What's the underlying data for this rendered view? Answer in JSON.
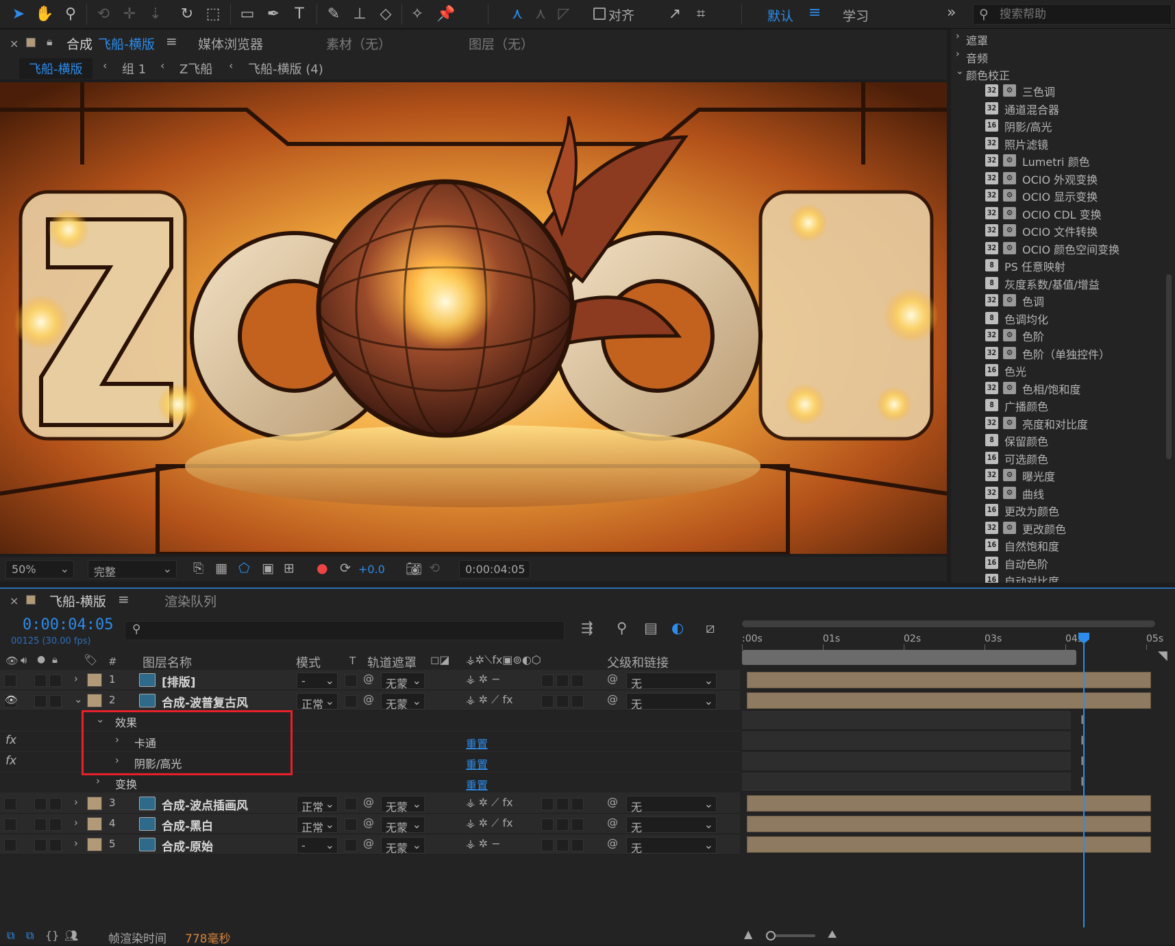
{
  "toolbar": {
    "align_label": "对齐",
    "workspace_default": "默认",
    "workspace_learn": "学习",
    "help_placeholder": "搜索帮助"
  },
  "comp_panel": {
    "tab_prefix": "合成",
    "tab_name": "飞船-横版",
    "tab_media": "媒体浏览器",
    "tab_footage": "素材（无）",
    "tab_layer": "图层（无）",
    "breadcrumbs": [
      "飞船-横版",
      "组 1",
      "Z飞船",
      "飞船-横版 (4)"
    ]
  },
  "viewer_controls": {
    "zoom": "50%",
    "resolution": "完整",
    "exposure": "+0.0",
    "timecode": "0:00:04:05"
  },
  "effects_panel": {
    "categories": [
      {
        "label": "遮罩",
        "expanded": false
      },
      {
        "label": "音频",
        "expanded": false
      },
      {
        "label": "颜色校正",
        "expanded": true
      }
    ],
    "items": [
      {
        "bits": "32",
        "gpu": true,
        "label": "三色调"
      },
      {
        "bits": "32",
        "gpu": false,
        "label": "通道混合器"
      },
      {
        "bits": "16",
        "gpu": false,
        "label": "阴影/高光"
      },
      {
        "bits": "32",
        "gpu": false,
        "label": "照片滤镜"
      },
      {
        "bits": "32",
        "gpu": true,
        "label": "Lumetri 颜色"
      },
      {
        "bits": "32",
        "gpu": true,
        "label": "OCIO 外观变换"
      },
      {
        "bits": "32",
        "gpu": true,
        "label": "OCIO 显示变换"
      },
      {
        "bits": "32",
        "gpu": true,
        "label": "OCIO CDL 变换"
      },
      {
        "bits": "32",
        "gpu": true,
        "label": "OCIO 文件转换"
      },
      {
        "bits": "32",
        "gpu": true,
        "label": "OCIO 颜色空间变换"
      },
      {
        "bits": "8",
        "gpu": false,
        "label": "PS 任意映射"
      },
      {
        "bits": "8",
        "gpu": false,
        "label": "灰度系数/基值/增益"
      },
      {
        "bits": "32",
        "gpu": true,
        "label": "色调"
      },
      {
        "bits": "8",
        "gpu": false,
        "label": "色调均化"
      },
      {
        "bits": "32",
        "gpu": true,
        "label": "色阶"
      },
      {
        "bits": "32",
        "gpu": true,
        "label": "色阶（单独控件）"
      },
      {
        "bits": "16",
        "gpu": false,
        "label": "色光"
      },
      {
        "bits": "32",
        "gpu": true,
        "label": "色相/饱和度"
      },
      {
        "bits": "8",
        "gpu": false,
        "label": "广播颜色"
      },
      {
        "bits": "32",
        "gpu": true,
        "label": "亮度和对比度"
      },
      {
        "bits": "8",
        "gpu": false,
        "label": "保留颜色"
      },
      {
        "bits": "16",
        "gpu": false,
        "label": "可选颜色"
      },
      {
        "bits": "32",
        "gpu": true,
        "label": "曝光度"
      },
      {
        "bits": "32",
        "gpu": true,
        "label": "曲线"
      },
      {
        "bits": "16",
        "gpu": false,
        "label": "更改为颜色"
      },
      {
        "bits": "32",
        "gpu": true,
        "label": "更改颜色"
      },
      {
        "bits": "16",
        "gpu": false,
        "label": "自然饱和度"
      },
      {
        "bits": "16",
        "gpu": false,
        "label": "自动色阶"
      },
      {
        "bits": "16",
        "gpu": false,
        "label": "自动对比度"
      }
    ]
  },
  "timeline": {
    "tab_name": "飞船-横版",
    "tab_render": "渲染队列",
    "current_time": "0:00:04:05",
    "frame_info": "00125 (30.00 fps)",
    "columns": {
      "index": "#",
      "layer_name": "图层名称",
      "mode": "模式",
      "t": "T",
      "track_matte": "轨道遮罩",
      "parent": "父级和链接"
    },
    "ruler": [
      ":00s",
      "01s",
      "02s",
      "03s",
      "04s",
      "05s"
    ],
    "layers": [
      {
        "index": "1",
        "name": "[排版]",
        "mode": "-",
        "matte": "无蒙",
        "parent": "无",
        "visible": false
      },
      {
        "index": "2",
        "name": "合成-波普复古风",
        "mode": "正常",
        "matte": "无蒙",
        "parent": "无",
        "visible": true
      },
      {
        "index": "3",
        "name": "合成-波点插画风",
        "mode": "正常",
        "matte": "无蒙",
        "parent": "无",
        "visible": false
      },
      {
        "index": "4",
        "name": "合成-黑白",
        "mode": "正常",
        "matte": "无蒙",
        "parent": "无",
        "visible": false
      },
      {
        "index": "5",
        "name": "合成-原始",
        "mode": "-",
        "matte": "无蒙",
        "parent": "无",
        "visible": false
      }
    ],
    "sub_rows": {
      "effects_group": "效果",
      "effect1": "卡通",
      "effect2": "阴影/高光",
      "transform": "变换",
      "reset": "重置",
      "fx": "fx"
    }
  },
  "status": {
    "render_label": "帧渲染时间",
    "render_value": "778毫秒"
  },
  "colors": {
    "accent": "#2d8ceb",
    "highlight_box": "#e8202a",
    "label_tan": "#b29a78"
  }
}
